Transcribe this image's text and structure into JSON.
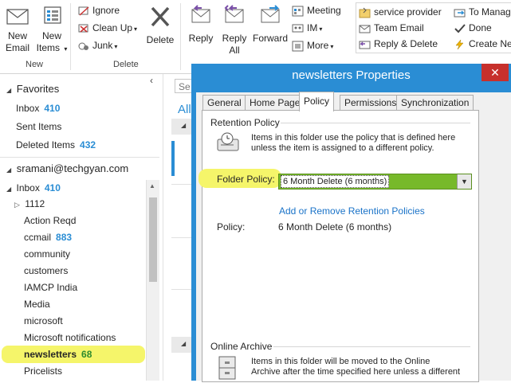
{
  "ribbon": {
    "new_group": {
      "new_email": "New\nEmail",
      "new_items": "New\nItems",
      "label": "New"
    },
    "delete_group": {
      "ignore": "Ignore",
      "clean_up": "Clean Up",
      "junk": "Junk",
      "delete": "Delete",
      "label": "Delete"
    },
    "respond_group": {
      "reply": "Reply",
      "reply_all": "Reply\nAll",
      "forward": "Forward",
      "meeting": "Meeting",
      "im": "IM",
      "more": "More"
    },
    "quick_steps": {
      "service_provider": "service provider",
      "team_email": "Team Email",
      "reply_delete": "Reply & Delete",
      "to_manager": "To Manag",
      "done": "Done",
      "create_new": "Create Ne"
    }
  },
  "folder_pane": {
    "favorites_title": "Favorites",
    "favorites": [
      {
        "label": "Inbox",
        "count": "410"
      },
      {
        "label": "Sent Items",
        "count": ""
      },
      {
        "label": "Deleted Items",
        "count": "432"
      }
    ],
    "account": "sramani@techgyan.com",
    "inbox": {
      "label": "Inbox",
      "count": "410"
    },
    "folders": [
      {
        "label": "1112",
        "count": ""
      },
      {
        "label": "Action Reqd",
        "count": ""
      },
      {
        "label": "ccmail",
        "count": "883"
      },
      {
        "label": "community",
        "count": ""
      },
      {
        "label": "customers",
        "count": ""
      },
      {
        "label": "IAMCP India",
        "count": ""
      },
      {
        "label": "Media",
        "count": ""
      },
      {
        "label": "microsoft",
        "count": ""
      },
      {
        "label": "Microsoft notifications",
        "count": ""
      },
      {
        "label": "newsletters",
        "count": "68"
      },
      {
        "label": "Pricelists",
        "count": ""
      }
    ]
  },
  "middle": {
    "search_stub": "Se",
    "all_stub": "All"
  },
  "dialog": {
    "title": "newsletters Properties",
    "close": "✕",
    "tabs": [
      "General",
      "Home Page",
      "Policy",
      "Permissions",
      "Synchronization"
    ],
    "retention_title": "Retention Policy",
    "retention_desc": "Items in this folder use the policy that is defined here unless the item is assigned to a different policy.",
    "folder_policy_label": "Folder Policy:",
    "folder_policy_value": "6 Month Delete (6 months)",
    "add_remove_link": "Add or Remove Retention Policies",
    "policy_label": "Policy:",
    "policy_value": "6 Month Delete (6 months)",
    "archive_title": "Online Archive",
    "archive_desc_line1": "Items in this folder will be moved to the Online",
    "archive_desc_line2": "Archive after the time specified here unless a different"
  },
  "colors": {
    "accent": "#2a8dd4",
    "highlight": "#f5f56a",
    "dropdown_green": "#77b92a",
    "close_red": "#c7302c"
  }
}
